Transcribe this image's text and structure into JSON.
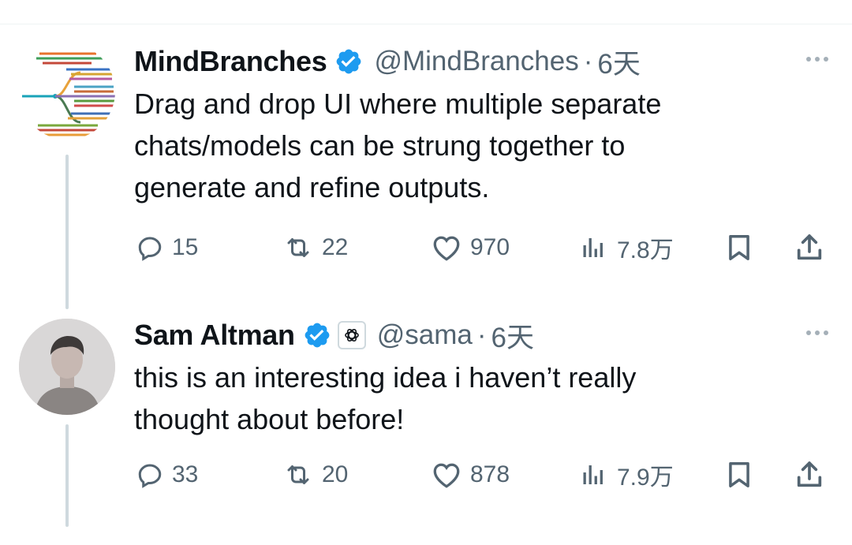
{
  "tweets": [
    {
      "author": {
        "name": "MindBranches",
        "handle": "@MindBranches",
        "verified": true,
        "avatar": "branch-logo"
      },
      "time": "6天",
      "text_lines": [
        "Drag and drop UI where multiple separate",
        "chats/models can be strung together to",
        "generate and refine outputs."
      ],
      "stats": {
        "replies": "15",
        "retweets": "22",
        "likes": "970",
        "views": "7.8万"
      }
    },
    {
      "author": {
        "name": "Sam Altman",
        "handle": "@sama",
        "verified": true,
        "affiliation": "openai-logo",
        "avatar": "profile-photo"
      },
      "time": "6天",
      "text_lines": [
        "this is an interesting idea i haven’t really",
        "thought about before!"
      ],
      "stats": {
        "replies": "33",
        "retweets": "20",
        "likes": "878",
        "views": "7.9万"
      }
    }
  ],
  "separator": "·",
  "icons": {
    "reply": "reply-icon",
    "retweet": "retweet-icon",
    "like": "like-icon",
    "views": "views-icon",
    "bookmark": "bookmark-icon",
    "share": "share-icon",
    "more": "more-icon",
    "verified": "verified-badge-icon"
  },
  "colors": {
    "verified": "#1d9bf0",
    "text": "#0f1419",
    "secondary": "#536471",
    "thread_line": "#cfd9de"
  }
}
